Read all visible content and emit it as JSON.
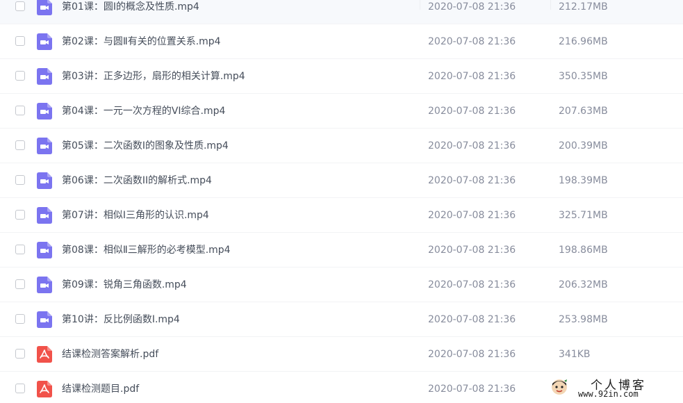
{
  "colors": {
    "video_icon": "#7b74f0",
    "pdf_icon": "#f1524a",
    "name_text": "#454d5a",
    "meta_text": "#878c9c"
  },
  "files": [
    {
      "name": "第01课：圆Ⅰ的概念及性质.mp4",
      "date": "2020-07-08 21:36",
      "size": "212.17MB",
      "icon": "video-icon"
    },
    {
      "name": "第02课：与圆Ⅱ有关的位置关系.mp4",
      "date": "2020-07-08 21:36",
      "size": "216.96MB",
      "icon": "video-icon"
    },
    {
      "name": "第03讲：正多边形，扇形的相关计算.mp4",
      "date": "2020-07-08 21:36",
      "size": "350.35MB",
      "icon": "video-icon"
    },
    {
      "name": "第04课：一元一次方程的VI综合.mp4",
      "date": "2020-07-08 21:36",
      "size": "207.63MB",
      "icon": "video-icon"
    },
    {
      "name": "第05课：二次函数Ⅰ的图象及性质.mp4",
      "date": "2020-07-08 21:36",
      "size": "200.39MB",
      "icon": "video-icon"
    },
    {
      "name": "第06课：二次函数II的解析式.mp4",
      "date": "2020-07-08 21:36",
      "size": "198.39MB",
      "icon": "video-icon"
    },
    {
      "name": "第07讲：相似Ⅰ三角形的认识.mp4",
      "date": "2020-07-08 21:36",
      "size": "325.71MB",
      "icon": "video-icon"
    },
    {
      "name": "第08课：相似Ⅱ三解形的必考模型.mp4",
      "date": "2020-07-08 21:36",
      "size": "198.86MB",
      "icon": "video-icon"
    },
    {
      "name": "第09课：锐角三角函数.mp4",
      "date": "2020-07-08 21:36",
      "size": "206.32MB",
      "icon": "video-icon"
    },
    {
      "name": "第10讲：反比例函数Ⅰ.mp4",
      "date": "2020-07-08 21:36",
      "size": "253.98MB",
      "icon": "video-icon"
    },
    {
      "name": "结课检测答案解析.pdf",
      "date": "2020-07-08 21:36",
      "size": "341KB",
      "icon": "pdf-icon"
    },
    {
      "name": "结课检测题目.pdf",
      "date": "2020-07-08 21:36",
      "size": "",
      "icon": "pdf-icon"
    }
  ],
  "watermark": {
    "title": "个人博客",
    "url": "www.92in.com"
  }
}
